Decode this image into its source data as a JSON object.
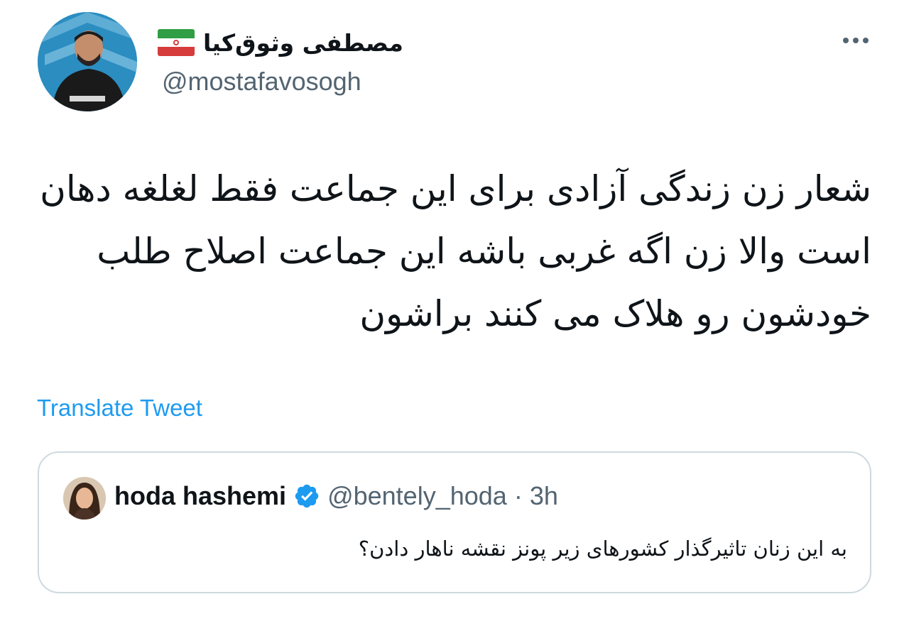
{
  "author": {
    "display_name": "مصطفی وثوق‌کیا",
    "handle": "@mostafavosogh",
    "flag_icon": "iran-flag-icon",
    "colors": {
      "flag_green": "#2f9e44",
      "flag_white": "#ffffff",
      "flag_red": "#d63c3c"
    }
  },
  "tweet": {
    "text": "شعار زن زندگی آزادی برای این جماعت فقط لغلغه دهان است والا زن اگه غربی باشه این جماعت اصلاح طلب خودشون رو هلاک می کنند براشون",
    "translate_label": "Translate Tweet"
  },
  "quoted": {
    "display_name": "hoda hashemi",
    "verified_icon": "verified-badge-icon",
    "handle": "@bentely_hoda",
    "separator": "·",
    "time": "3h",
    "text": "به این زنان تاثیرگذار کشورهای زیر پونز نقشه ناهار دادن؟"
  },
  "colors": {
    "text_primary": "#0f1419",
    "text_secondary": "#536471",
    "link": "#1d9bf0",
    "border": "#cfd9de",
    "verified": "#1d9bf0"
  }
}
